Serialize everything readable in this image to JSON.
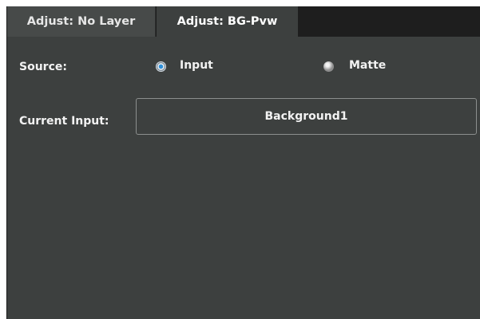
{
  "tabs": [
    {
      "label": "Adjust: No Layer",
      "active": false
    },
    {
      "label": "Adjust: BG-Pvw",
      "active": true
    }
  ],
  "source": {
    "label": "Source:",
    "options": [
      {
        "label": "Input",
        "selected": true
      },
      {
        "label": "Matte",
        "selected": false
      }
    ]
  },
  "current_input": {
    "label": "Current Input:",
    "value": "Background1"
  },
  "colors": {
    "panel_bg": "#3d403f",
    "tabbar_bg": "#1e1e1e",
    "inactive_tab_bg": "#474a49",
    "text": "#f2f2f2",
    "radio_selected": "#2e8fd8"
  }
}
